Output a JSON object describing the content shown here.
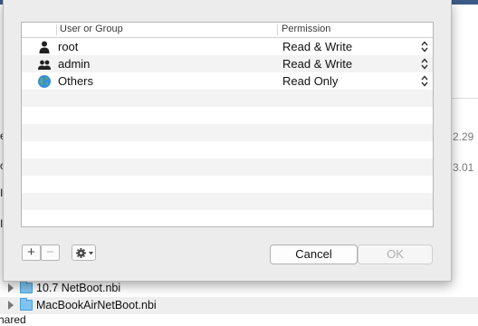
{
  "background": {
    "right_values": [
      "2.29",
      "3.01"
    ],
    "left_edge_glyphs": [
      "e",
      "c",
      "I",
      "I"
    ],
    "rows": [
      {
        "name": "10.7 NetBoot.nbi"
      },
      {
        "name": "MacBookAirNetBoot.nbi"
      }
    ],
    "footer_partial": "hared"
  },
  "sheet": {
    "columns": {
      "user_or_group": "User or Group",
      "permission": "Permission"
    },
    "rows": [
      {
        "icon": "single-user-icon",
        "name": "root",
        "permission": "Read & Write"
      },
      {
        "icon": "group-users-icon",
        "name": "admin",
        "permission": "Read & Write"
      },
      {
        "icon": "globe-icon",
        "name": "Others",
        "permission": "Read Only"
      }
    ],
    "add_label": "+",
    "remove_label": "−",
    "cancel_label": "Cancel",
    "ok_label": "OK"
  },
  "colors": {
    "accent_top": "#3b5a86",
    "folder": "#7fc3f0"
  }
}
